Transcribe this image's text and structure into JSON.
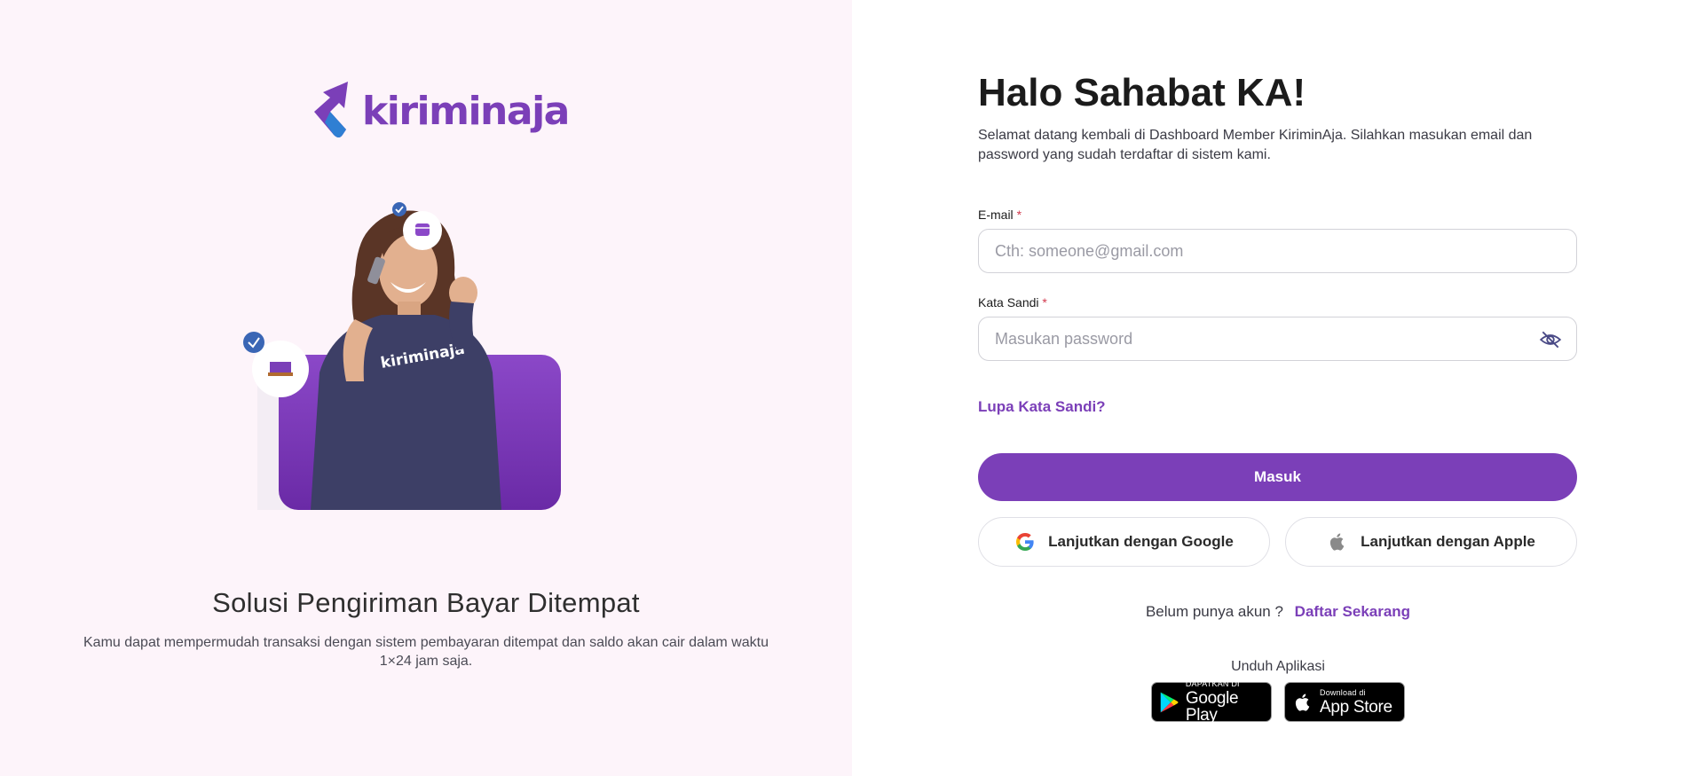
{
  "brand": {
    "name": "kiriminaja"
  },
  "hero": {
    "shirt_text": "kiriminaja",
    "title": "Solusi Pengiriman Bayar Ditempat",
    "description": "Kamu dapat mempermudah transaksi dengan sistem pembayaran ditempat dan saldo akan cair dalam waktu 1×24 jam saja."
  },
  "login": {
    "greeting": "Halo Sahabat KA!",
    "intro": "Selamat datang kembali di Dashboard Member KiriminAja. Silahkan masukan email dan password yang sudah terdaftar di sistem kami.",
    "email_label": "E-mail",
    "email_placeholder": "Cth: someone@gmail.com",
    "password_label": "Kata Sandi",
    "password_placeholder": "Masukan password",
    "required_mark": "*",
    "forgot_label": "Lupa Kata Sandi?",
    "submit_label": "Masuk",
    "google_label": "Lanjutkan dengan Google",
    "apple_label": "Lanjutkan dengan Apple",
    "no_account_text": "Belum punya akun ?",
    "signup_label": "Daftar Sekarang",
    "download_label": "Unduh Aplikasi",
    "google_play": {
      "small": "DAPATKAN DI",
      "big": "Google Play"
    },
    "app_store": {
      "small": "Download di",
      "big": "App Store"
    }
  },
  "colors": {
    "brand_purple": "#7b3fb8",
    "left_background": "#fdf4fa",
    "required": "#d23a4e"
  }
}
